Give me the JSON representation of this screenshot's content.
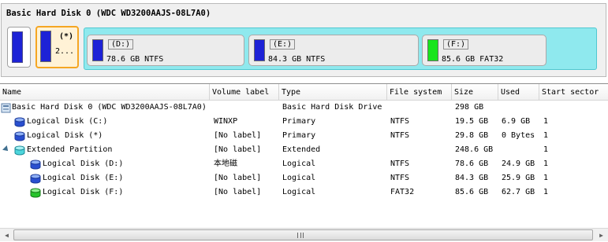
{
  "disk_map": {
    "title": "Basic Hard Disk 0 (WDC WD3200AAJS-08L7A0)",
    "partitions": {
      "c": {
        "color": "#1d22d6"
      },
      "star": {
        "label": "(*)",
        "sub": "2...",
        "color": "#1d22d6"
      },
      "d": {
        "label": "(D:)",
        "sub": "78.6 GB NTFS",
        "color": "#1d22d6"
      },
      "e": {
        "label": "(E:)",
        "sub": "84.3 GB NTFS",
        "color": "#1d22d6"
      },
      "f": {
        "label": "(F:)",
        "sub": "85.6 GB FAT32",
        "color": "#18e51c"
      }
    },
    "extended_color": "#8fe9ee",
    "selected_color": "#f5a623"
  },
  "columns": [
    "Name",
    "Volume label",
    "Type",
    "File system",
    "Size",
    "Used",
    "Start sector"
  ],
  "rows": [
    {
      "name": "Basic Hard Disk 0 (WDC WD3200AAJS-08L7A0)",
      "volume": "",
      "type": "Basic Hard Disk Drive",
      "fs": "",
      "size": "298 GB",
      "used": "",
      "start": "",
      "icon": "hard-disk-icon"
    },
    {
      "name": "Logical Disk (C:)",
      "volume": "WINXP",
      "type": "Primary",
      "fs": "NTFS",
      "size": "19.5 GB",
      "used": "6.9 GB",
      "start": "1",
      "icon": "blue-disk-icon"
    },
    {
      "name": "Logical Disk (*)",
      "volume": "[No label]",
      "type": "Primary",
      "fs": "NTFS",
      "size": "29.8 GB",
      "used": "0 Bytes",
      "start": "1",
      "icon": "blue-disk-icon"
    },
    {
      "name": "Extended Partition",
      "volume": "[No label]",
      "type": "Extended",
      "fs": "",
      "size": "248.6 GB",
      "used": "",
      "start": "1",
      "icon": "extended-partition-icon"
    },
    {
      "name": "Logical Disk (D:)",
      "volume": "本地磁",
      "type": "Logical",
      "fs": "NTFS",
      "size": "78.6 GB",
      "used": "24.9 GB",
      "start": "1",
      "icon": "blue-disk-icon"
    },
    {
      "name": "Logical Disk (E:)",
      "volume": "[No label]",
      "type": "Logical",
      "fs": "NTFS",
      "size": "84.3 GB",
      "used": "25.9 GB",
      "start": "1",
      "icon": "blue-disk-icon"
    },
    {
      "name": "Logical Disk (F:)",
      "volume": "[No label]",
      "type": "Logical",
      "fs": "FAT32",
      "size": "85.6 GB",
      "used": "62.7 GB",
      "start": "1",
      "icon": "green-disk-icon"
    }
  ],
  "scrollbar": {
    "left_arrow": "◀",
    "right_arrow": "▶"
  }
}
